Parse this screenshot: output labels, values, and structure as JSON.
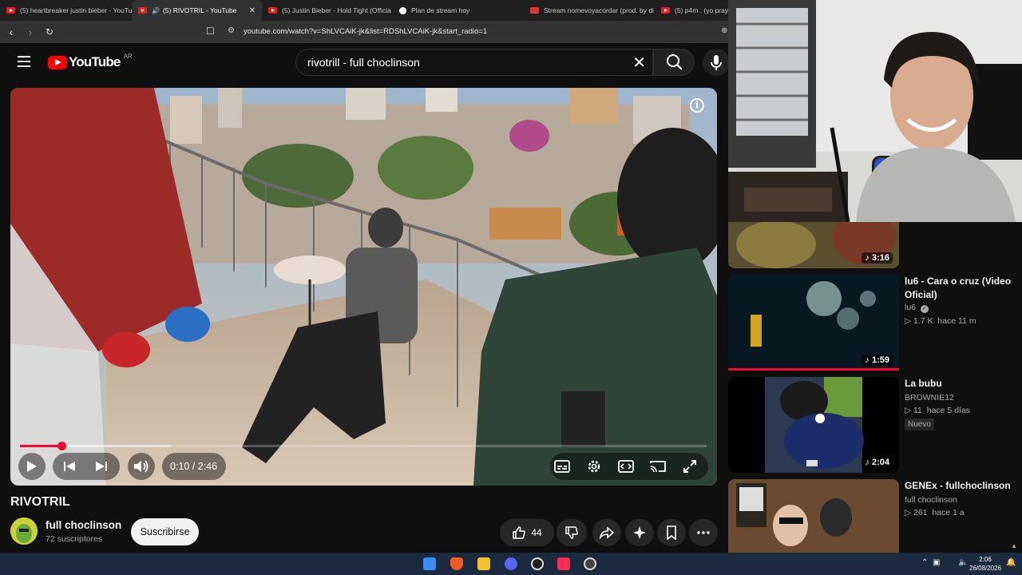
{
  "browser": {
    "tabs": [
      {
        "title": "(5) heartbreaker justin bieber - YouTu",
        "favicon": "youtube-icon",
        "active": false
      },
      {
        "title": "(5) RIVOTRIL - YouTube",
        "favicon": "youtube-icon",
        "active": true
      },
      {
        "title": "(5) Justin Bieber - Hold Tight (Officia",
        "favicon": "youtube-icon",
        "active": false
      },
      {
        "title": "Plan de stream hoy",
        "favicon": "chatgpt-icon",
        "active": false
      },
      {
        "title": "Stream nomevoyacordar (prod. by di",
        "favicon": "soundcloud-icon",
        "active": false
      },
      {
        "title": "(5) p4m . (yo pray)",
        "favicon": "youtube-icon",
        "active": false
      }
    ],
    "url": "youtube.com/watch?v=ShLVCAiK-jk&list=RDShLVCAiK-jk&start_radio=1"
  },
  "youtube": {
    "logo_text": "YouTube",
    "country_code": "AR",
    "search_value": "rivotrill - full choclinson"
  },
  "player": {
    "current_time": "0:10",
    "duration": "2:46",
    "time_display": "0:10 / 2:46",
    "progress_fraction": 0.06,
    "buffer_fraction": 0.22,
    "accent_color": "#ff0033"
  },
  "video": {
    "title": "RIVOTRIL",
    "channel_name": "full choclinson",
    "subscribers": "72 suscriptores",
    "subscribe_label": "Suscribirse",
    "likes": "44"
  },
  "sidebar": {
    "items": [
      {
        "duration": "3:16",
        "title": "",
        "channel": "",
        "views": "",
        "age": ""
      },
      {
        "duration": "1:59",
        "title": "lu6 - Cara o cruz (Video Oficial)",
        "channel": "lu6",
        "verified": true,
        "views": "1.7 K",
        "age": "hace 11 m",
        "watched_fraction": 1.0
      },
      {
        "duration": "2:04",
        "title": "La bubu",
        "channel": "BROWNIE12",
        "views": "11",
        "age": "hace 5 días",
        "badge": "Nuevo"
      },
      {
        "duration": "",
        "title": "GENEx - fullchoclinson",
        "channel": "full choclinson",
        "views": "261",
        "age": "hace 1 a"
      }
    ]
  },
  "taskbar": {
    "time": "2:06",
    "date": "26/08/2026"
  }
}
